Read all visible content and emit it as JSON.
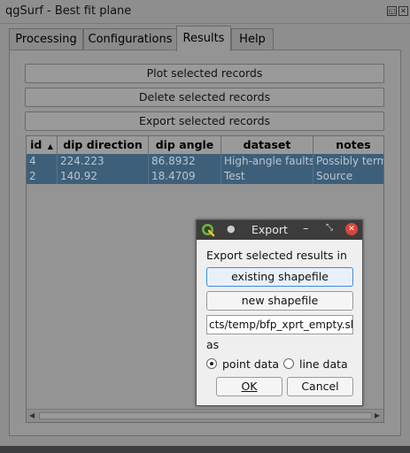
{
  "window": {
    "title": "qgSurf - Best fit plane"
  },
  "tabs": [
    {
      "label": "Processing"
    },
    {
      "label": "Configurations"
    },
    {
      "label": "Results"
    },
    {
      "label": "Help"
    }
  ],
  "actions": {
    "plot": "Plot selected records",
    "delete": "Delete selected records",
    "export": "Export selected records"
  },
  "table": {
    "columns": [
      "id",
      "dip direction",
      "dip angle",
      "dataset",
      "notes"
    ],
    "sort_indicator": "▲",
    "rows": [
      [
        "4",
        "224.223",
        "86.8932",
        "High-angle faults",
        "Possibly term"
      ],
      [
        "2",
        "140.92",
        "18.4709",
        "Test",
        "Source"
      ]
    ]
  },
  "dialog": {
    "title": "Export",
    "prompt": "Export selected results in",
    "existing_button": "existing shapefile",
    "new_button": "new shapefile",
    "path_value": "cts/temp/bfp_xprt_empty.shp",
    "as_label": "as",
    "point_option": "point data",
    "line_option": "line data",
    "ok_label": "OK",
    "cancel_label": "Cancel"
  },
  "colors": {
    "selected_row": "#3e5f79",
    "qgis_green": "#6cb33f",
    "close_red": "#d9463b"
  }
}
